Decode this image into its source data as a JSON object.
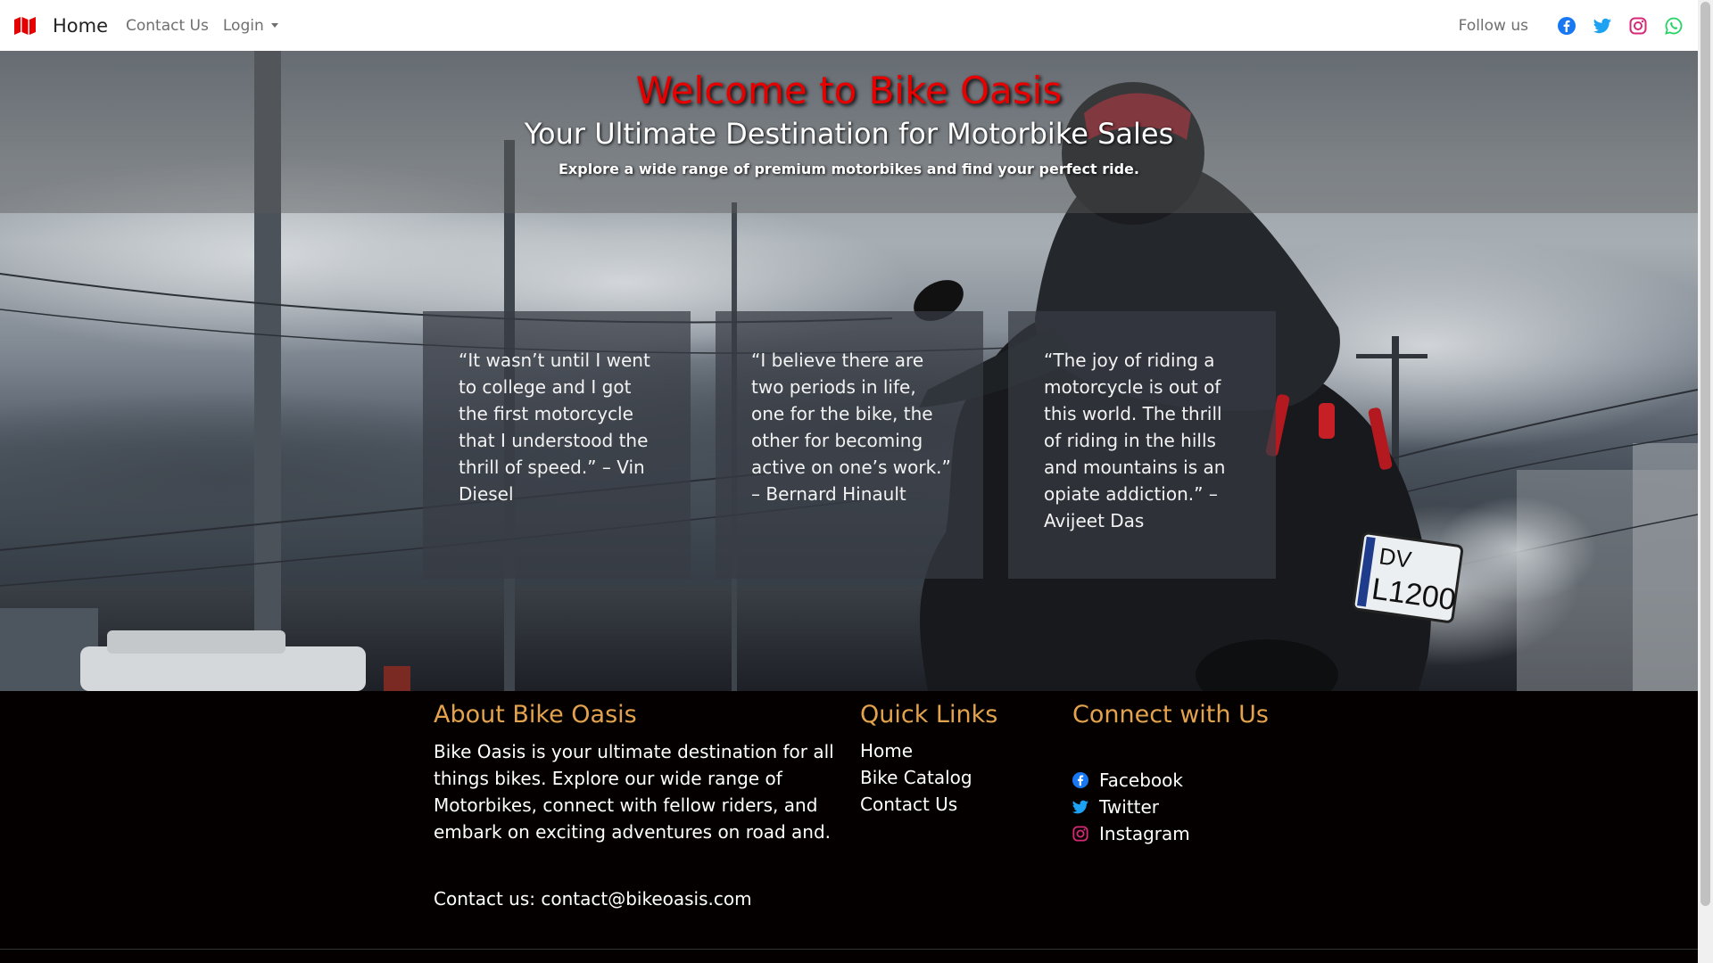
{
  "navbar": {
    "brand_label": "Home",
    "links": {
      "contact": "Contact Us",
      "login": "Login"
    },
    "follow_label": "Follow us",
    "social_icons": [
      "facebook-icon",
      "twitter-icon",
      "instagram-icon",
      "whatsapp-icon"
    ],
    "colors": {
      "brand": "#e60000",
      "facebook": "#1877f2",
      "twitter": "#1da1f2",
      "instagram": "#d62976",
      "whatsapp": "#25d366"
    }
  },
  "hero": {
    "title": "Welcome to Bike Oasis",
    "subtitle": "Your Ultimate Destination for Motorbike Sales",
    "tagline": "Explore a wide range of premium motorbikes and find your perfect ride.",
    "title_color": "#e60000",
    "quotes": [
      "“It wasn’t until I went to college and I got the first motorcycle that I understood the thrill of speed.” – Vin Diesel",
      "“I believe there are two periods in life, one for the bike, the other for becoming active on one’s work.” – Bernard Hinault",
      "“The joy of riding a motorcycle is out of this world. The thrill of riding in the hills and mountains is an opiate addiction.” – Avijeet Das"
    ]
  },
  "footer": {
    "about": {
      "title": "About Bike Oasis",
      "text": "Bike Oasis is your ultimate destination for all things bikes. Explore our wide range of Motorbikes, connect with fellow riders, and embark on exciting adventures on road and.",
      "contact": "Contact us: contact@bikeoasis.com"
    },
    "quick_links": {
      "title": "Quick Links",
      "items": [
        "Home",
        "Bike Catalog",
        "Contact Us"
      ]
    },
    "connect": {
      "title": "Connect with Us",
      "items": [
        "Facebook",
        "Twitter",
        "Instagram"
      ]
    },
    "heading_color": "#e3a34d"
  }
}
